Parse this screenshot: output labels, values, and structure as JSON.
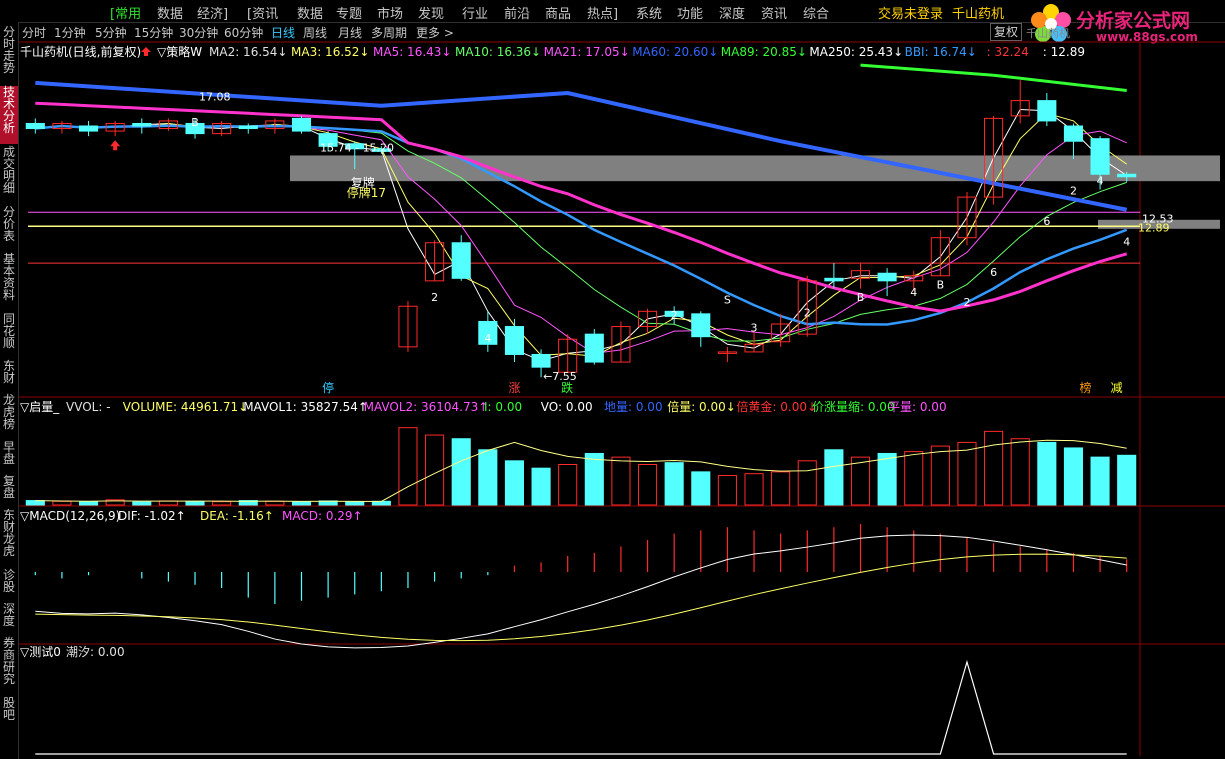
{
  "menu": {
    "items": [
      "[常用",
      "数据",
      "经济]",
      "[资讯",
      "数据",
      "专题",
      "市场",
      "发现",
      "行业",
      "前沿",
      "商品",
      "热点]",
      "系统",
      "功能",
      "深度",
      "资讯",
      "综合"
    ],
    "active_index": 0,
    "login_status": "交易未登录",
    "stock_name": "千山药机"
  },
  "logo": {
    "title": "分析家公式网",
    "url": "www.88gs.com"
  },
  "stock_tag": "千山药机",
  "sidebar": [
    {
      "label": "分时走势",
      "active": false
    },
    {
      "label": "技术分析",
      "active": true
    },
    {
      "label": "成交明细",
      "active": false
    },
    {
      "label": "分价表",
      "active": false
    },
    {
      "label": "基本资料",
      "active": false
    },
    {
      "label": "同花顺",
      "active": false
    },
    {
      "label": "东财",
      "active": false
    },
    {
      "label": "龙虎榜",
      "active": false
    },
    {
      "label": "早盘",
      "active": false
    },
    {
      "label": "复盘",
      "active": false
    },
    {
      "label": "东财龙虎",
      "active": false
    },
    {
      "label": "诊股",
      "active": false
    },
    {
      "label": "深度",
      "active": false
    },
    {
      "label": "券商研究",
      "active": false
    },
    {
      "label": "股吧",
      "active": false
    }
  ],
  "periods": [
    "分时",
    "1分钟",
    "5分钟",
    "15分钟",
    "30分钟",
    "60分钟",
    "日线",
    "周线",
    "月线",
    "多周期",
    "更多 >"
  ],
  "active_period": "日线",
  "fq_button": "复权",
  "price_legend": {
    "title": "千山药机(日线,前复权)",
    "strategy": "策略W",
    "items": [
      {
        "text": "MA2: 16.54",
        "arrow": "↓",
        "color": "#e0e0e0"
      },
      {
        "text": "MA3: 16.52",
        "arrow": "↓",
        "color": "#ffff66"
      },
      {
        "text": "MA5: 16.43",
        "arrow": "↓",
        "color": "#ff55ff"
      },
      {
        "text": "MA10: 16.36",
        "arrow": "↓",
        "color": "#66ff66"
      },
      {
        "text": "MA21: 17.05",
        "arrow": "↓",
        "color": "#ff55ff"
      },
      {
        "text": "MA60: 20.60",
        "arrow": "↓",
        "color": "#3366ff"
      },
      {
        "text": "MA89: 20.85",
        "arrow": "↓",
        "color": "#33ff33"
      },
      {
        "text": "MA250: 25.43",
        "arrow": "↓",
        "color": "#ffffff"
      },
      {
        "text": "BBI: 16.74",
        "arrow": "↓",
        "color": "#3399ff"
      },
      {
        "text": ": 32.24",
        "arrow": "",
        "color": "#ff3333"
      },
      {
        "text": ": 12.89",
        "arrow": "",
        "color": "#ffffff"
      }
    ]
  },
  "price_annotations": {
    "high_label": "17.08",
    "range_label": "15.74 - 15.20",
    "resume_label": "复牌",
    "halt_label": "停牌17",
    "low_label": "7.55",
    "right_label_1": "12.53",
    "right_label_2": "12.89",
    "num_labels": [
      "B",
      "2",
      "2",
      "4",
      "3",
      "2",
      "4",
      "6",
      "B",
      "2",
      "4",
      "6",
      "2",
      "4",
      "B",
      "S"
    ]
  },
  "event_markers": [
    {
      "text": "停",
      "color": "#33ccff"
    },
    {
      "text": "涨",
      "color": "#ff4040"
    },
    {
      "text": "跌",
      "color": "#33ff33"
    },
    {
      "text": "榜",
      "color": "#ff9900"
    },
    {
      "text": "减",
      "color": "#ffff33"
    }
  ],
  "volume_legend": {
    "title": "启量_",
    "items": [
      {
        "text": "VVOL: -",
        "arrow": "",
        "color": "#e0e0e0"
      },
      {
        "text": "VOLUME: 44961.71",
        "arrow": "↓",
        "color": "#ffff66"
      },
      {
        "text": "MAVOL1: 35827.54",
        "arrow": "↑",
        "color": "#ffffff"
      },
      {
        "text": "MAVOL2: 36104.73",
        "arrow": "↑",
        "color": "#ff55ff"
      },
      {
        "text": "I: 0.00",
        "arrow": "",
        "color": "#33ff33"
      },
      {
        "text": "VO: 0.00",
        "arrow": "",
        "color": "#ffffff"
      },
      {
        "text": "地量: 0.00",
        "arrow": "",
        "color": "#3366ff"
      },
      {
        "text": "倍量: 0.00",
        "arrow": "↓",
        "color": "#ffff66"
      },
      {
        "text": "倍黄金: 0.00",
        "arrow": "↓",
        "color": "#ff3333"
      },
      {
        "text": "价涨量缩: 0.00",
        "arrow": "",
        "color": "#33ff33"
      },
      {
        "text": "平量: 0.00",
        "arrow": "",
        "color": "#ff55ff"
      }
    ]
  },
  "macd_legend": {
    "title": "MACD(12,26,9)",
    "items": [
      {
        "text": "DIF: -1.02",
        "arrow": "↑",
        "color": "#ffffff"
      },
      {
        "text": "DEA: -1.16",
        "arrow": "↑",
        "color": "#ffff66"
      },
      {
        "text": "MACD: 0.29",
        "arrow": "↑",
        "color": "#ff55ff"
      }
    ]
  },
  "test_legend": {
    "title": "测试0",
    "items": [
      {
        "text": "潮汐: 0.00",
        "arrow": "",
        "color": "#e0e0e0"
      }
    ]
  },
  "colors": {
    "up": "#ff2a2a",
    "down": "#54ffff",
    "ma_slow": "#3366ff",
    "ma_pink": "#ff33cc",
    "ma_green": "#33ff33",
    "resistance_band": "#808080",
    "line_yellow": "#ffff88",
    "line_magenta": "#ff55ff",
    "line_red": "#ff3333"
  },
  "chart_data": {
    "type": "candlestick",
    "candles": [
      [
        17.0,
        16.8,
        17.2,
        16.6
      ],
      [
        16.8,
        17.0,
        17.1,
        16.6
      ],
      [
        16.9,
        16.7,
        17.1,
        16.5
      ],
      [
        16.7,
        17.0,
        17.1,
        16.5
      ],
      [
        17.0,
        16.9,
        17.2,
        16.6
      ],
      [
        16.8,
        17.1,
        17.2,
        16.7
      ],
      [
        17.0,
        16.6,
        17.2,
        16.4
      ],
      [
        16.6,
        17.0,
        17.1,
        16.5
      ],
      [
        16.9,
        16.8,
        17.0,
        16.6
      ],
      [
        16.8,
        17.1,
        17.2,
        16.6
      ],
      [
        17.2,
        16.7,
        17.3,
        16.6
      ],
      [
        16.6,
        16.1,
        16.7,
        15.9
      ],
      [
        16.2,
        16.0,
        16.3,
        15.2
      ],
      [
        16.0,
        15.9,
        16.1,
        15.8
      ],
      [
        8.2,
        9.8,
        10.0,
        8.0
      ],
      [
        10.8,
        12.3,
        12.4,
        10.8
      ],
      [
        12.3,
        10.9,
        12.6,
        10.8
      ],
      [
        9.2,
        8.3,
        9.6,
        8.0
      ],
      [
        9.0,
        7.9,
        9.3,
        7.6
      ],
      [
        7.9,
        7.4,
        8.1,
        7.0
      ],
      [
        7.2,
        8.5,
        8.7,
        7.2
      ],
      [
        8.7,
        7.6,
        8.9,
        7.5
      ],
      [
        7.6,
        9.0,
        9.2,
        7.6
      ],
      [
        9.0,
        9.6,
        9.7,
        8.7
      ],
      [
        9.6,
        9.4,
        9.8,
        9.1
      ],
      [
        9.5,
        8.6,
        9.6,
        8.2
      ],
      [
        8.0,
        8.0,
        8.2,
        7.6
      ],
      [
        8.0,
        8.3,
        8.8,
        8.0
      ],
      [
        8.4,
        9.1,
        9.5,
        8.2
      ],
      [
        8.7,
        10.8,
        11.0,
        8.6
      ],
      [
        10.9,
        10.8,
        11.5,
        10.5
      ],
      [
        10.9,
        11.2,
        11.5,
        10.5
      ],
      [
        11.1,
        10.8,
        11.3,
        10.2
      ],
      [
        10.8,
        11.0,
        11.2,
        10.4
      ],
      [
        11.0,
        12.5,
        12.8,
        11.0
      ],
      [
        12.5,
        14.1,
        14.3,
        12.2
      ],
      [
        14.1,
        17.2,
        17.3,
        13.8
      ],
      [
        17.3,
        17.9,
        18.7,
        17.0
      ],
      [
        17.9,
        17.1,
        18.2,
        16.9
      ],
      [
        16.9,
        16.3,
        17.0,
        15.6
      ],
      [
        16.4,
        15.0,
        16.5,
        14.4
      ],
      [
        15.0,
        14.9,
        15.1,
        14.7
      ]
    ],
    "volume": [
      12,
      10,
      9,
      14,
      8,
      11,
      10,
      9,
      12,
      10,
      9,
      11,
      8,
      10,
      210,
      190,
      180,
      150,
      120,
      100,
      110,
      140,
      130,
      110,
      115,
      90,
      80,
      85,
      90,
      120,
      150,
      130,
      140,
      145,
      160,
      170,
      200,
      180,
      170,
      155,
      130,
      135
    ],
    "macd_hist": [
      -0.1,
      -0.2,
      -0.1,
      0.0,
      -0.2,
      -0.3,
      -0.4,
      -0.5,
      -0.8,
      -1.0,
      -0.9,
      -0.8,
      -0.7,
      -0.6,
      -0.5,
      -0.3,
      -0.2,
      -0.1,
      0.2,
      0.3,
      0.5,
      0.6,
      0.8,
      1.0,
      1.2,
      1.3,
      1.4,
      1.3,
      1.2,
      1.3,
      1.4,
      1.5,
      1.4,
      1.3,
      1.2,
      1.1,
      0.9,
      0.8,
      0.7,
      0.6,
      0.5,
      0.4
    ],
    "tide": [
      0,
      0,
      0,
      0,
      0,
      0,
      0,
      0,
      0,
      0,
      0,
      0,
      0,
      0,
      0,
      0,
      0,
      0,
      0,
      0,
      0,
      0,
      0,
      0,
      0,
      0,
      0,
      0,
      0,
      0,
      0,
      0,
      0,
      0,
      0,
      1.0,
      0,
      0,
      0,
      0,
      0,
      0
    ]
  }
}
